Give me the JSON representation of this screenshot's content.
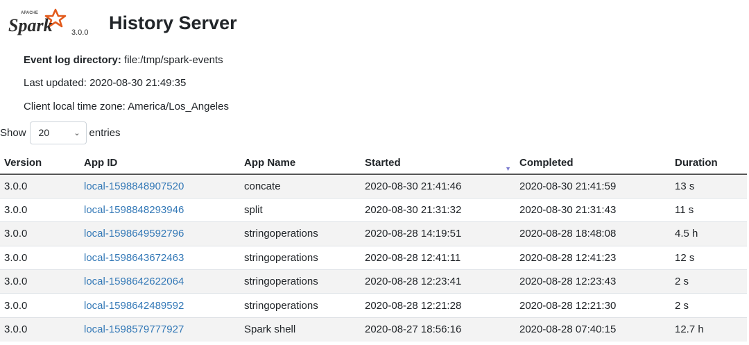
{
  "header": {
    "logo_small_text": "APACHE",
    "logo_text": "Spark",
    "version": "3.0.0",
    "title": "History Server"
  },
  "info": {
    "event_log_label": "Event log directory:",
    "event_log_value": "file:/tmp/spark-events",
    "last_updated": "Last updated: 2020-08-30 21:49:35",
    "timezone": "Client local time zone: America/Los_Angeles"
  },
  "entries": {
    "show_label": "Show",
    "selected": "20",
    "entries_label": "entries"
  },
  "table": {
    "columns": [
      "Version",
      "App ID",
      "App Name",
      "Started",
      "Completed",
      "Duration"
    ],
    "sort_indicator": "▼",
    "rows": [
      {
        "version": "3.0.0",
        "app_id": "local-1598848907520",
        "name": "concate",
        "started": "2020-08-30 21:41:46",
        "completed": "2020-08-30 21:41:59",
        "duration": "13 s"
      },
      {
        "version": "3.0.0",
        "app_id": "local-1598848293946",
        "name": "split",
        "started": "2020-08-30 21:31:32",
        "completed": "2020-08-30 21:31:43",
        "duration": "11 s"
      },
      {
        "version": "3.0.0",
        "app_id": "local-1598649592796",
        "name": "stringoperations",
        "started": "2020-08-28 14:19:51",
        "completed": "2020-08-28 18:48:08",
        "duration": "4.5 h"
      },
      {
        "version": "3.0.0",
        "app_id": "local-1598643672463",
        "name": "stringoperations",
        "started": "2020-08-28 12:41:11",
        "completed": "2020-08-28 12:41:23",
        "duration": "12 s"
      },
      {
        "version": "3.0.0",
        "app_id": "local-1598642622064",
        "name": "stringoperations",
        "started": "2020-08-28 12:23:41",
        "completed": "2020-08-28 12:23:43",
        "duration": "2 s"
      },
      {
        "version": "3.0.0",
        "app_id": "local-1598642489592",
        "name": "stringoperations",
        "started": "2020-08-28 12:21:28",
        "completed": "2020-08-28 12:21:30",
        "duration": "2 s"
      },
      {
        "version": "3.0.0",
        "app_id": "local-1598579777927",
        "name": "Spark shell",
        "started": "2020-08-27 18:56:16",
        "completed": "2020-08-28 07:40:15",
        "duration": "12.7 h"
      }
    ]
  },
  "colors": {
    "link": "#3479b7",
    "stripe": "#f3f3f3",
    "spark_orange": "#e25a1c"
  }
}
